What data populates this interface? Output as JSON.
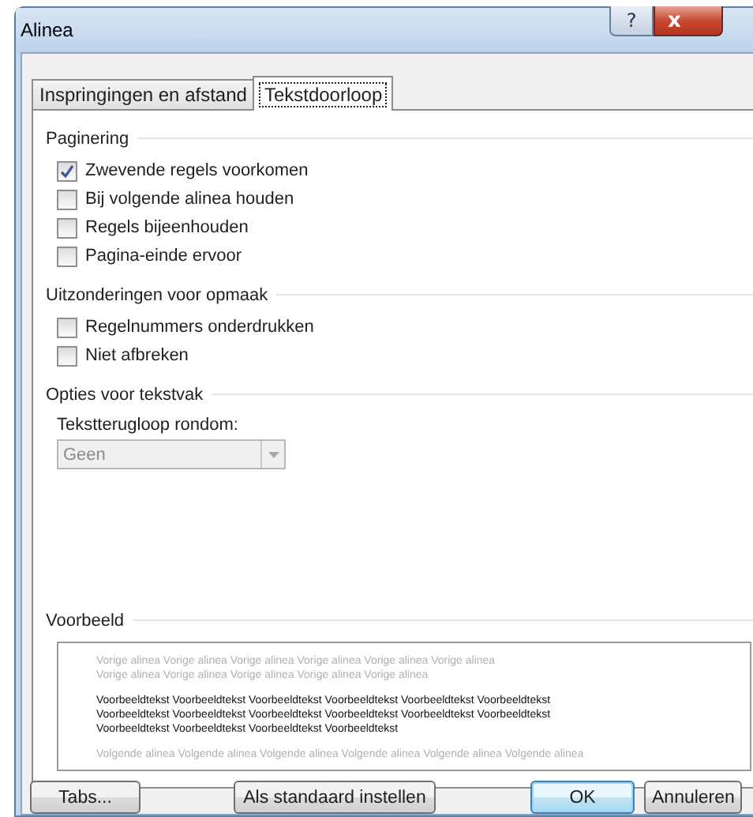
{
  "window": {
    "title": "Alinea",
    "help_button": "?",
    "close_button": "x"
  },
  "tabs": [
    {
      "label": "Inspringingen en afstand",
      "selected": false
    },
    {
      "label": "Tekstdoorloop",
      "selected": true
    }
  ],
  "sections": [
    {
      "title": "Paginering",
      "items": [
        {
          "kind": "checkbox",
          "label": "Zwevende regels voorkomen",
          "checked": true
        },
        {
          "kind": "checkbox",
          "label": "Bij volgende alinea houden",
          "checked": false
        },
        {
          "kind": "checkbox",
          "label": "Regels bijeenhouden",
          "checked": false
        },
        {
          "kind": "checkbox",
          "label": "Pagina-einde ervoor",
          "checked": false
        }
      ]
    },
    {
      "title": "Uitzonderingen voor opmaak",
      "items": [
        {
          "kind": "checkbox",
          "label": "Regelnummers onderdrukken",
          "checked": false
        },
        {
          "kind": "checkbox",
          "label": "Niet afbreken",
          "checked": false
        }
      ]
    },
    {
      "title": "Opties voor tekstvak",
      "items": [
        {
          "kind": "dropdown",
          "label": "Tekstterugloop rondom:",
          "value": "Geen",
          "disabled": true
        }
      ]
    }
  ],
  "preview": {
    "title": "Voorbeeld",
    "paragraphs": [
      {
        "kind": "previous",
        "lines": [
          "Vorige alinea Vorige alinea Vorige alinea Vorige alinea Vorige alinea Vorige alinea",
          "Vorige alinea Vorige alinea Vorige alinea Vorige alinea Vorige alinea"
        ]
      },
      {
        "kind": "sample",
        "lines": [
          "Voorbeeldtekst Voorbeeldtekst Voorbeeldtekst Voorbeeldtekst Voorbeeldtekst Voorbeeldtekst",
          "Voorbeeldtekst Voorbeeldtekst Voorbeeldtekst Voorbeeldtekst Voorbeeldtekst Voorbeeldtekst",
          "Voorbeeldtekst Voorbeeldtekst Voorbeeldtekst Voorbeeldtekst"
        ]
      },
      {
        "kind": "next",
        "lines": [
          "Volgende alinea Volgende alinea Volgende alinea Volgende alinea Volgende alinea Volgende alinea"
        ]
      }
    ]
  },
  "buttons": [
    {
      "label": "Tabs...",
      "default": false
    },
    {
      "label": "Als standaard instellen",
      "default": false
    },
    {
      "label": "OK",
      "default": true
    },
    {
      "label": "Annuleren",
      "default": false
    }
  ]
}
